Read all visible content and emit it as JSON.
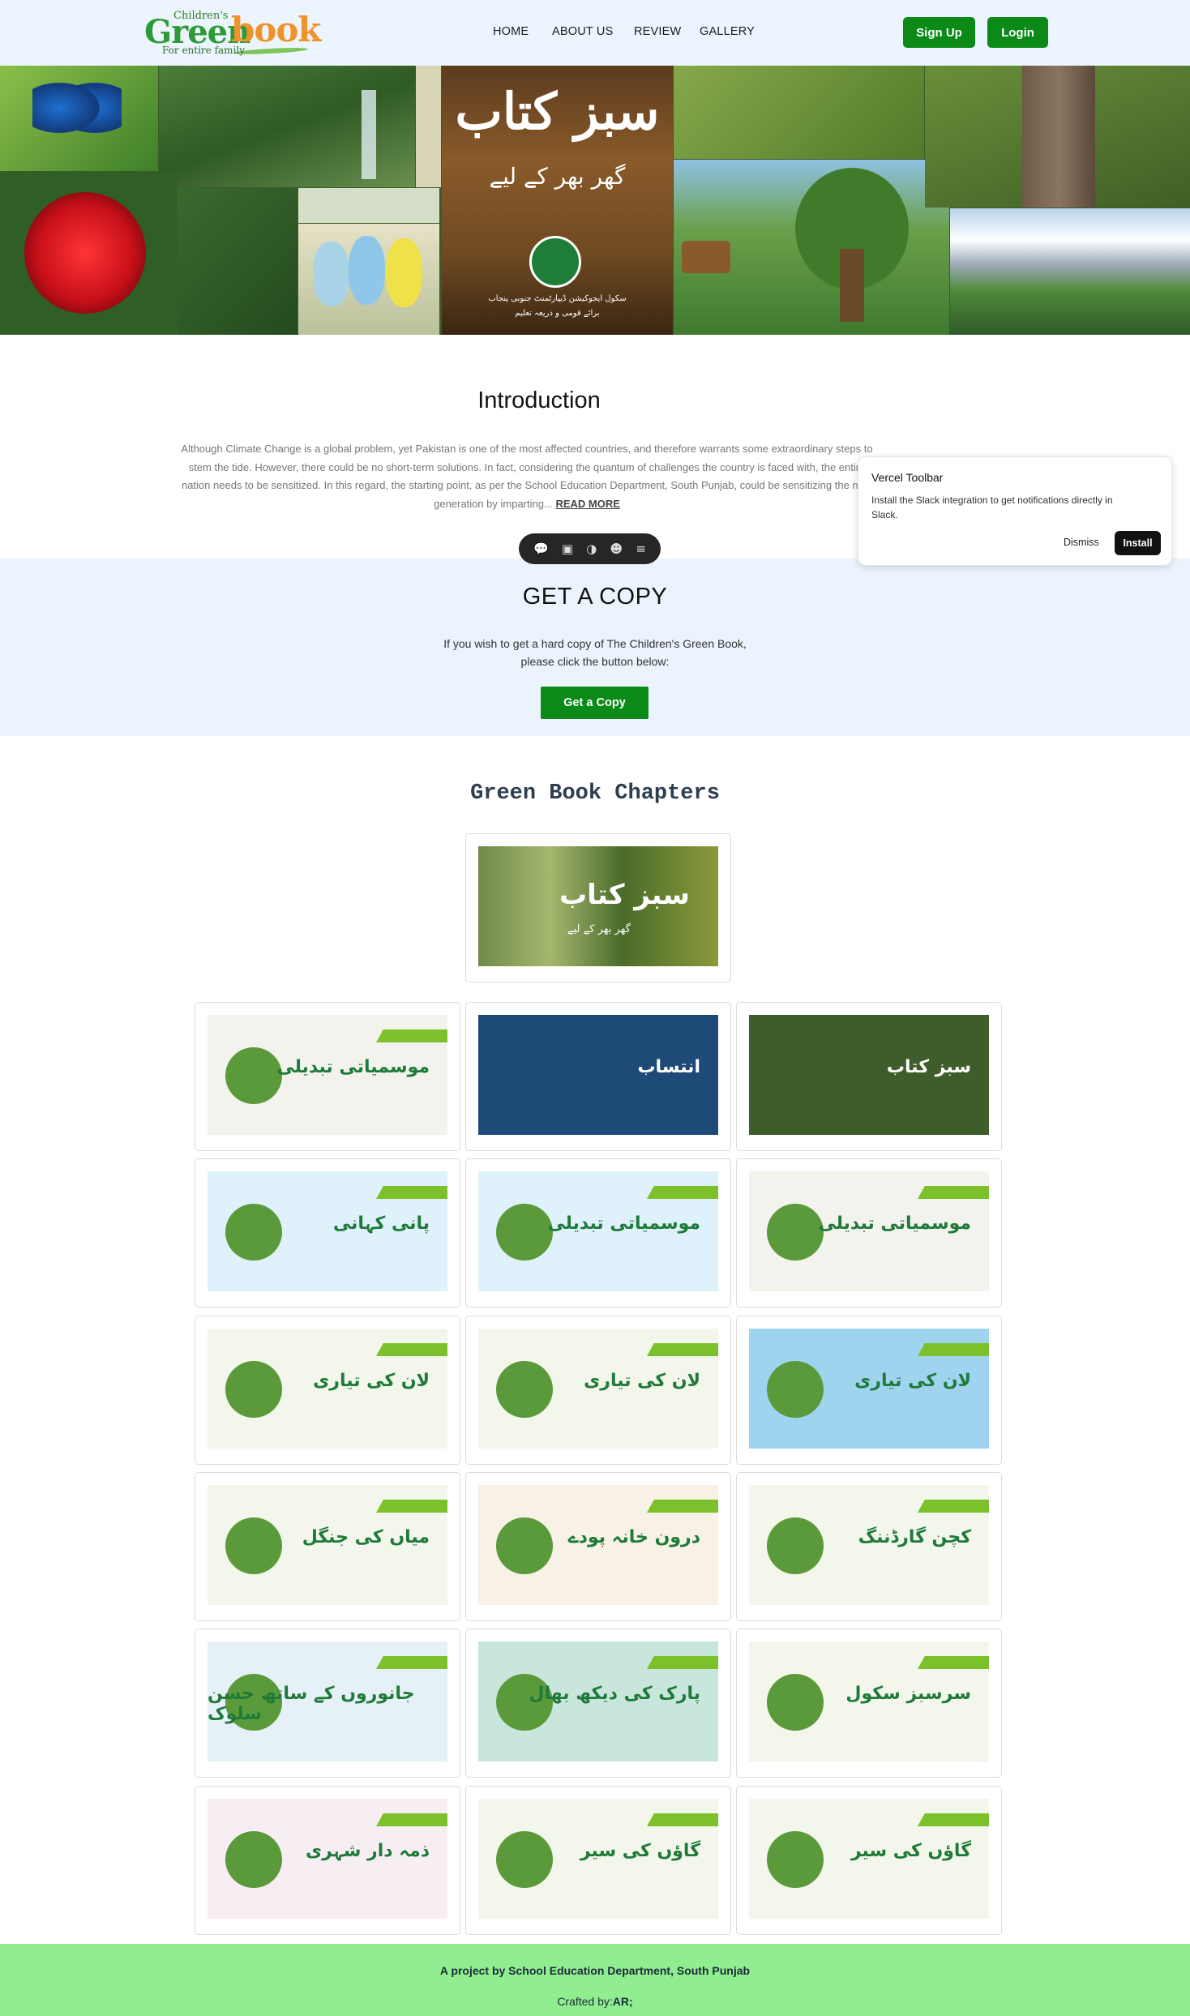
{
  "header": {
    "logo": {
      "small": "Children's",
      "word1": "Green",
      "word2": "book",
      "tagline": "For entire family"
    },
    "nav": [
      "HOME",
      "ABOUT US",
      "REVIEW",
      "GALLERY"
    ],
    "signup_label": "Sign Up",
    "login_label": "Login",
    "brand_green": "#0b8a17"
  },
  "hero": {
    "urdu_title": "سبز کتاب",
    "urdu_subtitle": "گھر بھر کے لیے",
    "urdu_credit1": "سکول ایجوکیشن ڈیپارٹمنٹ جنوبی پنجاب",
    "urdu_credit2": "برائے قومی و ذریعہ تعلیم"
  },
  "intro": {
    "title": "Introduction",
    "text": "Although Climate Change is a global problem, yet Pakistan is one of the most affected countries, and therefore warrants some extraordinary steps to stem the tide. However, there could be no short-term solutions. In fact, considering the quantum of challenges the country is faced with, the entire nation needs to be sensitized. In this regard, the starting point, as per the School Education Department, South Punjab, could be sensitizing the next generation by imparting...",
    "read_more": "READ MORE"
  },
  "vercel_toolbar": {
    "title": "Vercel Toolbar",
    "description": "Install the Slack integration to get notifications directly in Slack.",
    "dismiss": "Dismiss",
    "install": "Install",
    "icons": [
      "comment-icon",
      "inbox-icon",
      "toggle-icon",
      "user-plus-icon",
      "menu-icon"
    ]
  },
  "get_copy": {
    "title": "GET A COPY",
    "text_line1": "If you wish to get a hard copy of The Children's Green Book,",
    "text_line2": "please click the button below:",
    "button": "Get a Copy"
  },
  "chapters": {
    "title": "Green Book Chapters",
    "cover": {
      "urdu": "سبز کتاب",
      "sub": "گھر بھر کے لیے"
    },
    "cards": [
      {
        "urdu": "موسمیاتی تبدیلی",
        "theme": "#f3f3ee"
      },
      {
        "urdu": "انتساب",
        "theme": "#1e4a78"
      },
      {
        "urdu": "سبز کتاب",
        "theme": "#3f5d2a"
      },
      {
        "urdu": "پانی کہانی",
        "theme": "#dff1fb"
      },
      {
        "urdu": "موسمیاتی تبدیلی",
        "theme": "#dff1fb"
      },
      {
        "urdu": "موسمیاتی تبدیلی",
        "theme": "#f3f3ee"
      },
      {
        "urdu": "لان کی تیاری",
        "theme": "#f3f6ea"
      },
      {
        "urdu": "لان کی تیاری",
        "theme": "#f3f6ea"
      },
      {
        "urdu": "لان کی تیاری",
        "theme": "#9fd4ef"
      },
      {
        "urdu": "میاں کی جنگل",
        "theme": "#f3f6ea"
      },
      {
        "urdu": "درون خانہ پودے",
        "theme": "#f7f1e6"
      },
      {
        "urdu": "کچن گارڈننگ",
        "theme": "#f3f6ea"
      },
      {
        "urdu": "جانوروں کے ساتھ حسن سلوک",
        "theme": "#e6f1f7"
      },
      {
        "urdu": "پارک کی دیکھ بھال",
        "theme": "#c8e6dc"
      },
      {
        "urdu": "سرسبز سکول",
        "theme": "#f3f6ea"
      },
      {
        "urdu": "ذمہ دار شہری",
        "theme": "#f7eef3"
      },
      {
        "urdu": "گاؤں کی سیر",
        "theme": "#f3f6ea"
      },
      {
        "urdu": "گاؤں کی سیر",
        "theme": "#f3f6ea"
      }
    ]
  },
  "footer": {
    "line1": "A project by School Education Department, South Punjab",
    "crafted_prefix": "Crafted by:",
    "crafted_name": "AR;"
  }
}
